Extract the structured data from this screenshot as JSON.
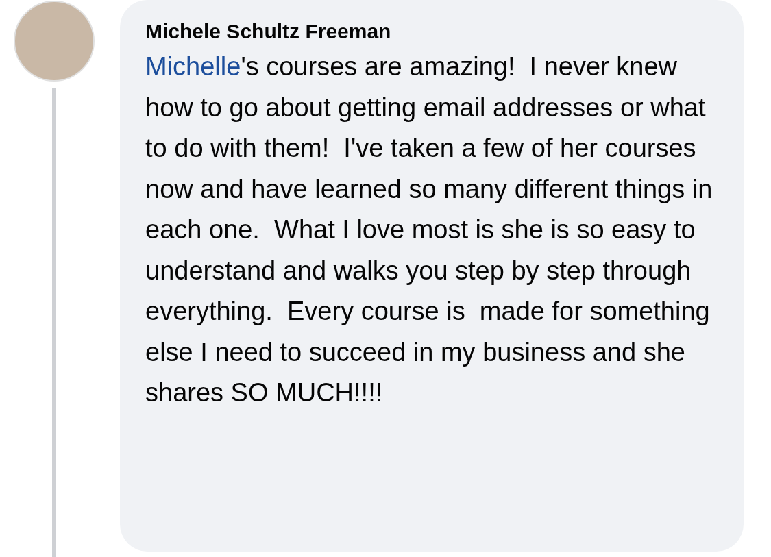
{
  "comment": {
    "author": "Michele Schultz Freeman",
    "mention": "Michelle",
    "text": "'s courses are amazing!  I never knew how to go about getting email addresses or what to do with them!  I've taken a few of her courses now and have learned so many different things in each one.  What I love most is she is so easy to understand and walks you step by step through everything.  Every course is  made for something else I need to succeed in my business and she shares SO MUCH!!!!"
  }
}
